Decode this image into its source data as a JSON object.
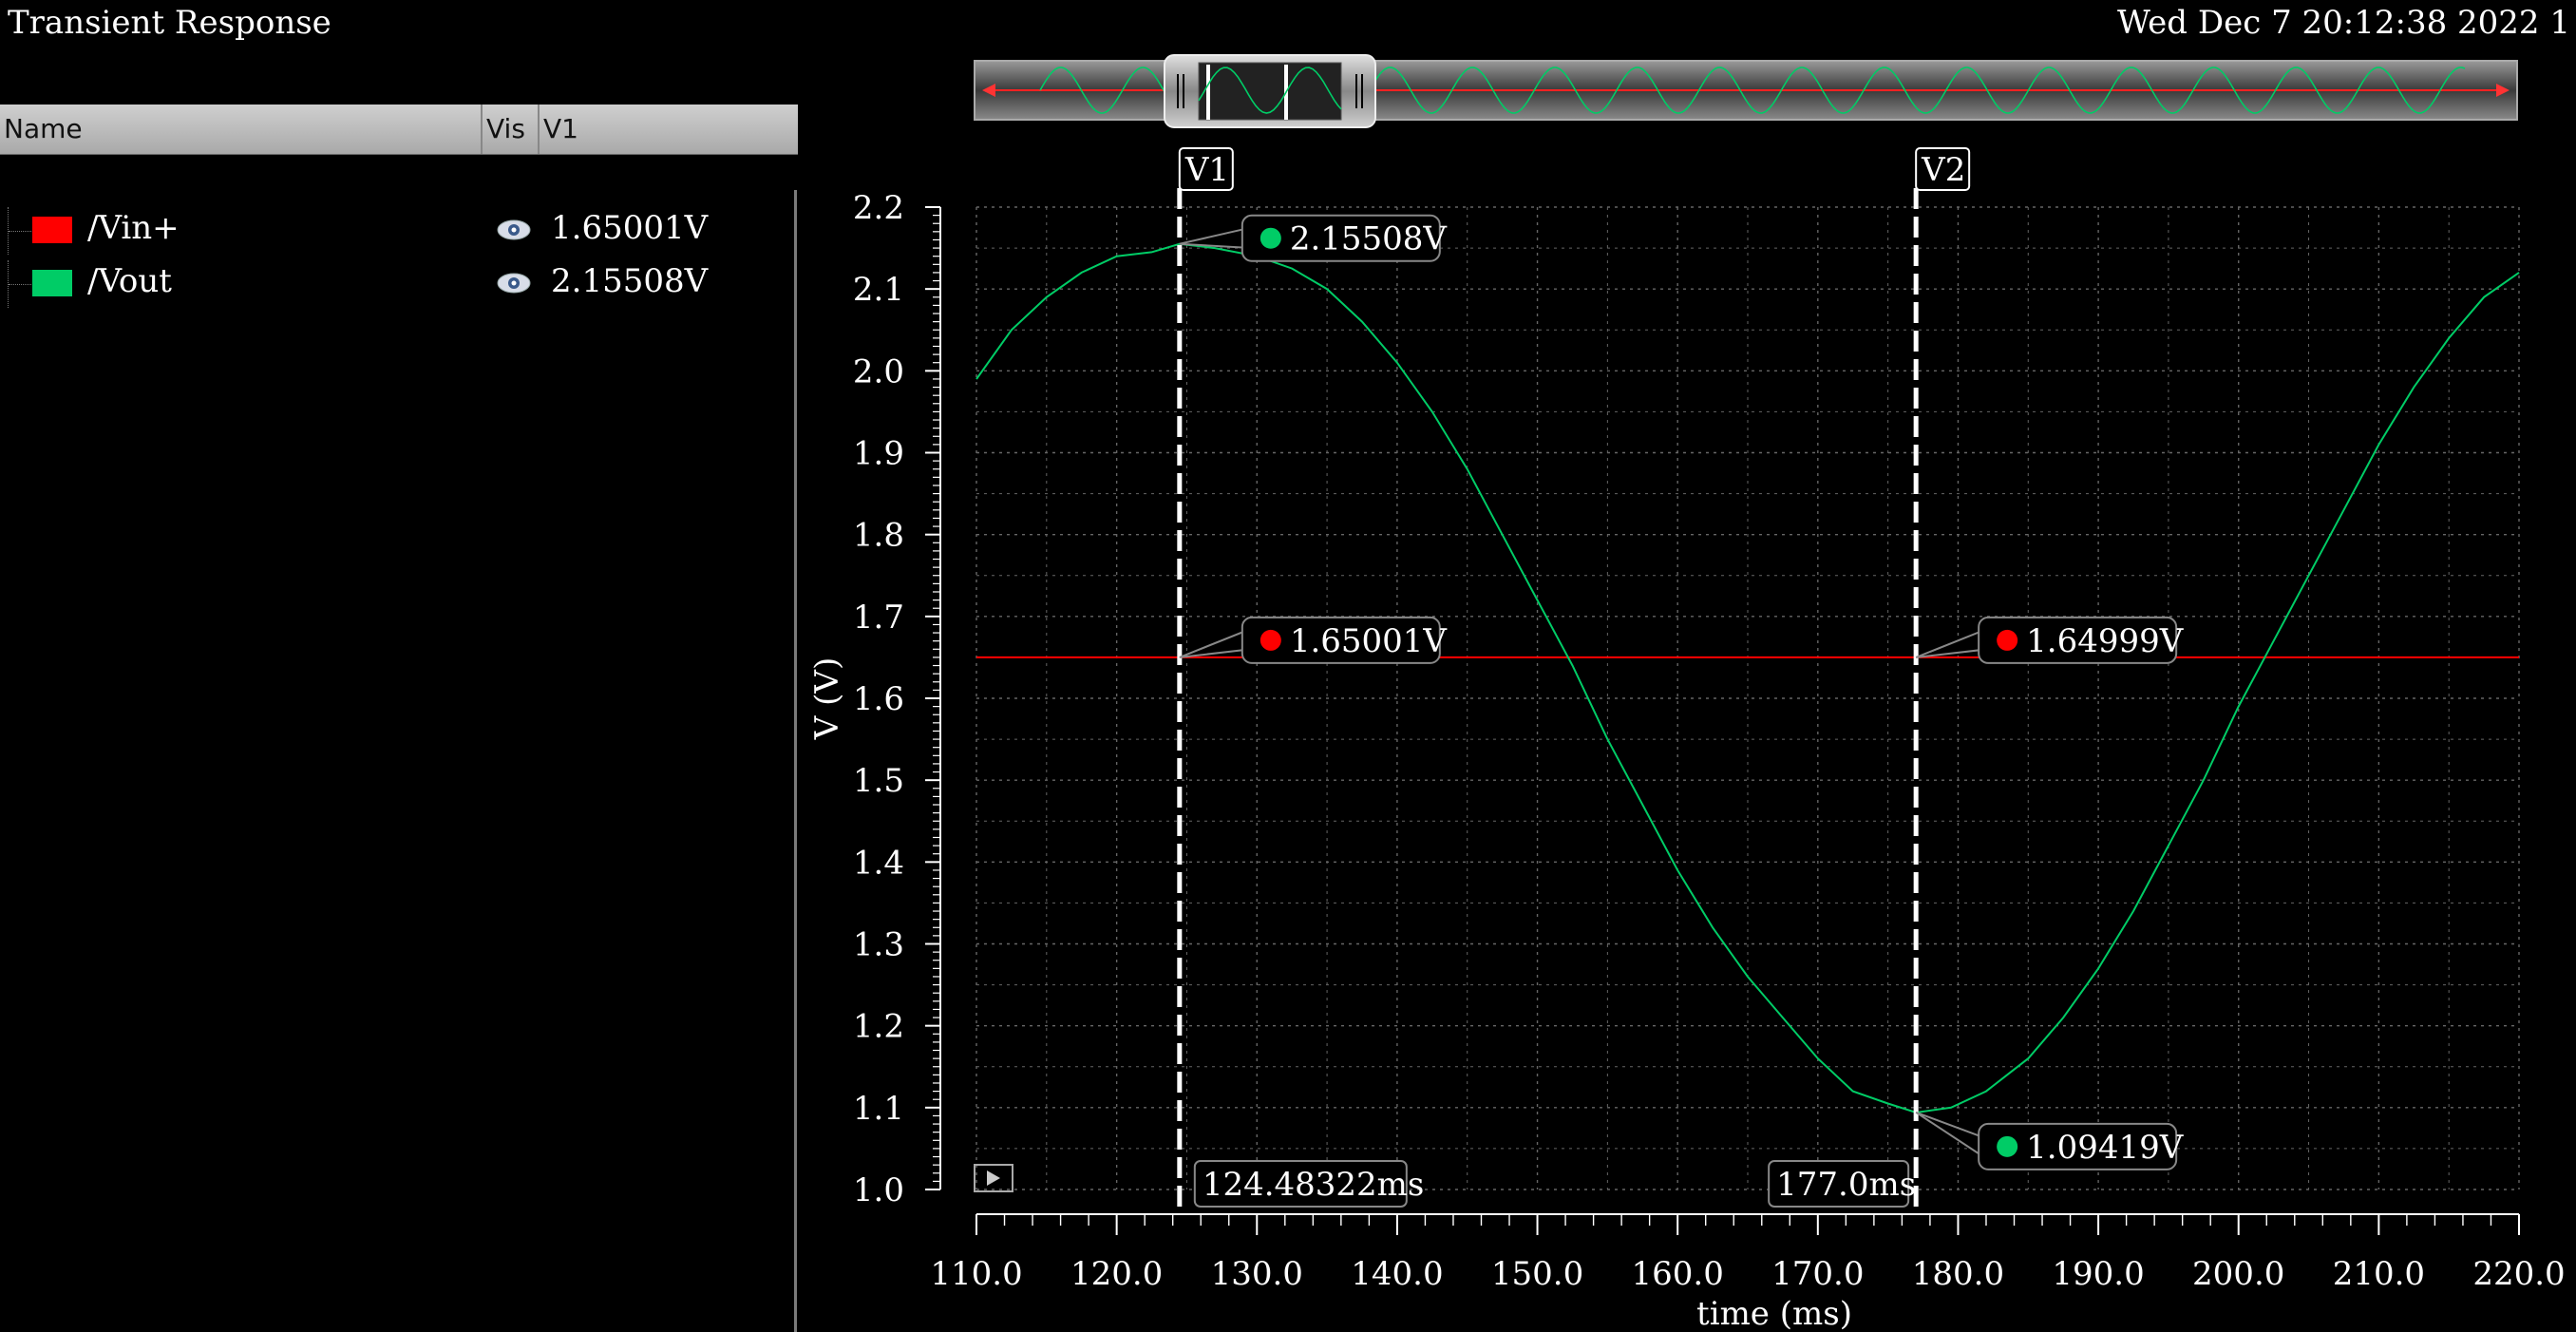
{
  "window": {
    "title": "Transient Response",
    "datetime": "Wed Dec 7 20:12:38 2022  1"
  },
  "signal_panel": {
    "columns": [
      "Name",
      "Vis",
      "V1"
    ],
    "signals": [
      {
        "name": "/Vin+",
        "color": "#ff0000",
        "visible_icon": "eye-icon",
        "value": "1.65001V"
      },
      {
        "name": "/Vout",
        "color": "#00cc66",
        "visible_icon": "eye-icon",
        "value": "2.15508V"
      }
    ]
  },
  "markers": {
    "vertical": [
      {
        "label": "V1",
        "time_ms": 124.48322,
        "time_text": "124.48322ms"
      },
      {
        "label": "V2",
        "time_ms": 177.0,
        "time_text": "177.0ms"
      }
    ],
    "points": [
      {
        "marker": "V1",
        "signal": "/Vout",
        "value_V": 2.15508,
        "text": "2.15508V",
        "color": "#00cc66"
      },
      {
        "marker": "V1",
        "signal": "/Vin+",
        "value_V": 1.65001,
        "text": "1.65001V",
        "color": "#ff0000"
      },
      {
        "marker": "V2",
        "signal": "/Vin+",
        "value_V": 1.64999,
        "text": "1.64999V",
        "color": "#ff0000"
      },
      {
        "marker": "V2",
        "signal": "/Vout",
        "value_V": 1.09419,
        "text": "1.09419V",
        "color": "#00cc66"
      }
    ]
  },
  "chart_data": {
    "type": "line",
    "title": "Transient Response",
    "xlabel": "time (ms)",
    "ylabel": "V (V)",
    "xlim": [
      110.0,
      220.0
    ],
    "ylim": [
      1.0,
      2.2
    ],
    "x_ticks": [
      "110.0",
      "120.0",
      "130.0",
      "140.0",
      "150.0",
      "160.0",
      "170.0",
      "180.0",
      "190.0",
      "200.0",
      "210.0",
      "220.0"
    ],
    "y_ticks": [
      "1.0",
      "1.1",
      "1.2",
      "1.3",
      "1.4",
      "1.5",
      "1.6",
      "1.7",
      "1.8",
      "1.9",
      "2.0",
      "2.1",
      "2.2"
    ],
    "grid": true,
    "series": [
      {
        "name": "/Vin+",
        "color": "#ff0000",
        "x": [
          110.0,
          220.0
        ],
        "y": [
          1.65,
          1.65
        ]
      },
      {
        "name": "/Vout",
        "color": "#00cc66",
        "x": [
          110.0,
          112.5,
          115.0,
          117.5,
          120.0,
          122.5,
          124.48,
          127.0,
          130.0,
          132.5,
          135.0,
          137.5,
          140.0,
          142.5,
          145.0,
          147.5,
          150.0,
          152.5,
          155.0,
          157.5,
          160.0,
          162.5,
          165.0,
          167.5,
          170.0,
          172.5,
          175.0,
          177.0,
          179.5,
          182.0,
          185.0,
          187.5,
          190.0,
          192.5,
          195.0,
          197.5,
          200.0,
          202.5,
          205.0,
          207.5,
          210.0,
          212.5,
          215.0,
          217.5,
          220.0
        ],
        "y": [
          1.99,
          2.05,
          2.09,
          2.12,
          2.14,
          2.145,
          2.155,
          2.15,
          2.14,
          2.125,
          2.1,
          2.06,
          2.01,
          1.95,
          1.88,
          1.8,
          1.72,
          1.64,
          1.55,
          1.47,
          1.39,
          1.32,
          1.26,
          1.21,
          1.16,
          1.12,
          1.105,
          1.094,
          1.1,
          1.12,
          1.16,
          1.21,
          1.27,
          1.34,
          1.42,
          1.5,
          1.59,
          1.67,
          1.75,
          1.83,
          1.91,
          1.98,
          2.04,
          2.09,
          2.12
        ]
      }
    ]
  }
}
